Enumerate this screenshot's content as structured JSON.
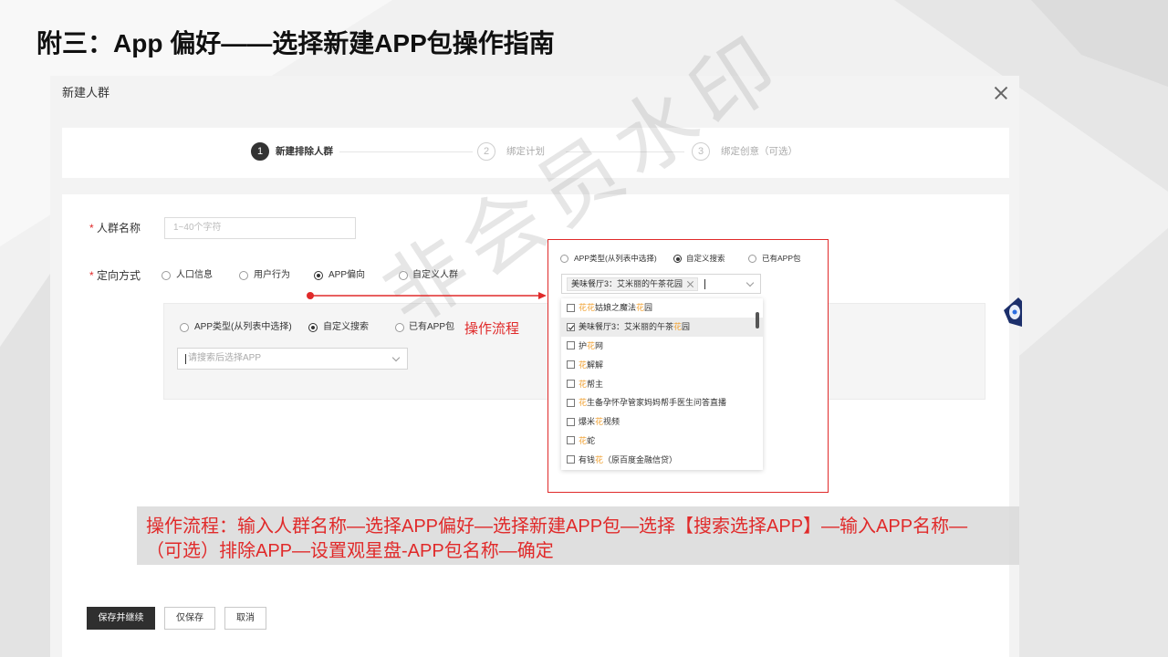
{
  "slide": {
    "title": "附三：App 偏好——选择新建APP包操作指南",
    "watermark": "非会员水印"
  },
  "dialog": {
    "title": "新建人群"
  },
  "steps": [
    {
      "number": "1",
      "label": "新建排除人群",
      "state": "active"
    },
    {
      "number": "2",
      "label": "绑定计划",
      "state": "pending"
    },
    {
      "number": "3",
      "label": "绑定创意（可选）",
      "state": "pending"
    }
  ],
  "form": {
    "required_mark": "*",
    "name_label": "人群名称",
    "name_placeholder": "1~40个字符",
    "targeting_label": "定向方式",
    "targeting_options": [
      {
        "label": "人口信息",
        "selected": false
      },
      {
        "label": "用户行为",
        "selected": false
      },
      {
        "label": "APP偏向",
        "selected": true
      },
      {
        "label": "自定义人群",
        "selected": false
      }
    ],
    "app_source_options": [
      {
        "label": "APP类型(从列表中选择)",
        "selected": false
      },
      {
        "label": "自定义搜索",
        "selected": true
      },
      {
        "label": "已有APP包",
        "selected": false
      }
    ],
    "flow_hint": "操作流程",
    "app_search_placeholder": "请搜索后选择APP"
  },
  "zoom_panel": {
    "app_source_options": [
      {
        "label": "APP类型(从列表中选择)",
        "selected": false
      },
      {
        "label": "自定义搜索",
        "selected": true
      },
      {
        "label": "已有APP包",
        "selected": false
      }
    ],
    "selected_tag": "美味餐厅3：艾米丽的午茶花园",
    "dropdown_items": [
      {
        "checked": false,
        "segments": [
          {
            "text": "花花",
            "highlight": true
          },
          {
            "text": "姑娘之魔法",
            "highlight": false
          },
          {
            "text": "花",
            "highlight": true
          },
          {
            "text": "园",
            "highlight": false
          }
        ]
      },
      {
        "checked": true,
        "segments": [
          {
            "text": "美味餐厅3：艾米丽的午茶",
            "highlight": false
          },
          {
            "text": "花",
            "highlight": true
          },
          {
            "text": "园",
            "highlight": false
          }
        ]
      },
      {
        "checked": false,
        "segments": [
          {
            "text": "护",
            "highlight": false
          },
          {
            "text": "花",
            "highlight": true
          },
          {
            "text": "网",
            "highlight": false
          }
        ]
      },
      {
        "checked": false,
        "segments": [
          {
            "text": "花",
            "highlight": true
          },
          {
            "text": "解解",
            "highlight": false
          }
        ]
      },
      {
        "checked": false,
        "segments": [
          {
            "text": "花",
            "highlight": true
          },
          {
            "text": "帮主",
            "highlight": false
          }
        ]
      },
      {
        "checked": false,
        "segments": [
          {
            "text": "花",
            "highlight": true
          },
          {
            "text": "生备孕怀孕管家妈妈帮手医生问答直播",
            "highlight": false
          }
        ]
      },
      {
        "checked": false,
        "segments": [
          {
            "text": "爆米",
            "highlight": false
          },
          {
            "text": "花",
            "highlight": true
          },
          {
            "text": "视频",
            "highlight": false
          }
        ]
      },
      {
        "checked": false,
        "segments": [
          {
            "text": "花",
            "highlight": true
          },
          {
            "text": "蛇",
            "highlight": false
          }
        ]
      },
      {
        "checked": false,
        "segments": [
          {
            "text": "有钱",
            "highlight": false
          },
          {
            "text": "花",
            "highlight": true
          },
          {
            "text": "（原百度金融信贷）",
            "highlight": false
          }
        ]
      }
    ]
  },
  "note": {
    "lines": [
      "操作流程：输入人群名称—选择APP偏好—选择新建APP包—选择【搜索选择APP】—输入APP名称—",
      "（可选）排除APP—设置观星盘-APP包名称—确定"
    ]
  },
  "buttons": {
    "save_continue": "保存并继续",
    "save_only": "仅保存",
    "cancel": "取消"
  },
  "colors": {
    "annotation_red": "#e02a2a",
    "highlight_orange": "#f0a030",
    "primary_dark": "#333333",
    "selected_row": "#ececec"
  },
  "icons": {
    "close": "close-icon",
    "select_arrow": "chevron-down-icon",
    "tag_remove": "close-icon",
    "checked_box": "checkbox-checked-icon",
    "flow_pointer": "arrow-right-icon"
  }
}
